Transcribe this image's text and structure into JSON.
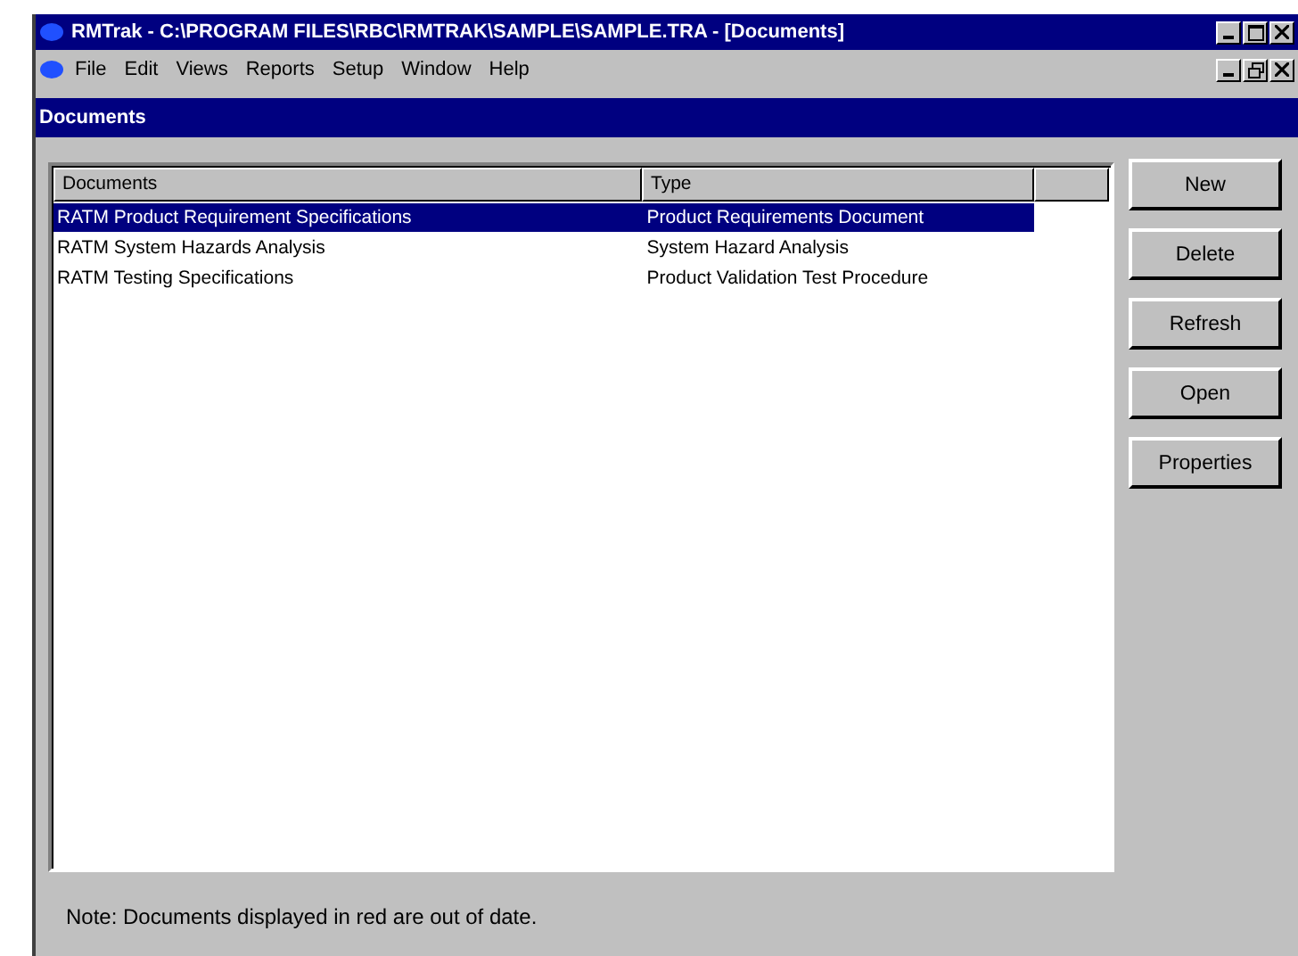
{
  "window": {
    "title": "RMTrak - C:\\PROGRAM FILES\\RBC\\RMTRAK\\SAMPLE\\SAMPLE.TRA - [Documents]"
  },
  "menu": [
    "File",
    "Edit",
    "Views",
    "Reports",
    "Setup",
    "Window",
    "Help"
  ],
  "child_window": {
    "title": "Documents"
  },
  "table": {
    "columns": [
      "Documents",
      "Type"
    ],
    "rows": [
      {
        "cells": [
          "RATM Product Requirement Specifications",
          "Product Requirements Document"
        ],
        "selected": true
      },
      {
        "cells": [
          "RATM System Hazards Analysis",
          "System Hazard Analysis"
        ],
        "selected": false
      },
      {
        "cells": [
          "RATM Testing Specifications",
          "Product Validation Test Procedure"
        ],
        "selected": false
      }
    ]
  },
  "buttons": [
    "New",
    "Delete",
    "Refresh",
    "Open",
    "Properties"
  ],
  "note": "Note: Documents displayed in red are out of date."
}
